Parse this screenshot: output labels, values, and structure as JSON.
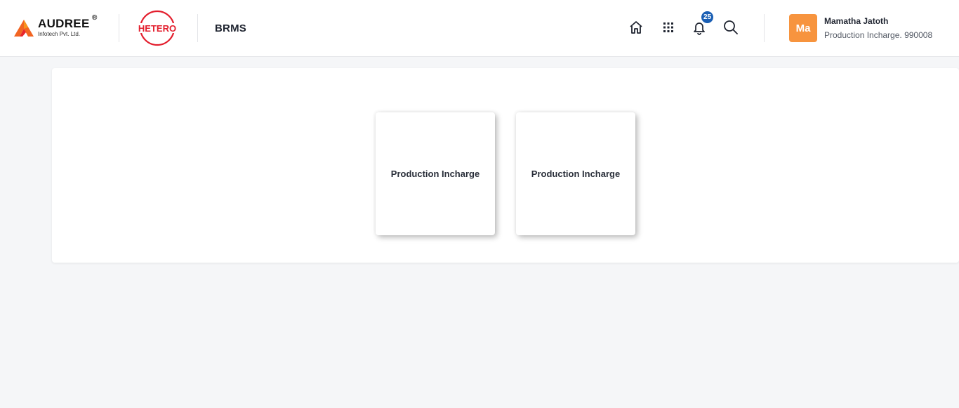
{
  "header": {
    "brand": {
      "name": "AUDREE",
      "registered": "®",
      "subtitle": "Infotech Pvt. Ltd."
    },
    "client_logo_text": "HETERO",
    "app_name": "BRMS",
    "icons": [
      "home-icon",
      "apps-grid-icon",
      "bell-icon",
      "search-icon"
    ],
    "notifications_count": "25",
    "user": {
      "initials": "Ma",
      "name": "Mamatha Jatoth",
      "role": "Production Incharge. 990008"
    }
  },
  "colors": {
    "accent_orange": "#f7943e",
    "badge_blue": "#1a5fb4",
    "hetero_red": "#e31e2d",
    "background": "#f5f6f8"
  },
  "main": {
    "role_cards": [
      {
        "label": "Production Incharge"
      },
      {
        "label": "Production Incharge"
      }
    ]
  }
}
